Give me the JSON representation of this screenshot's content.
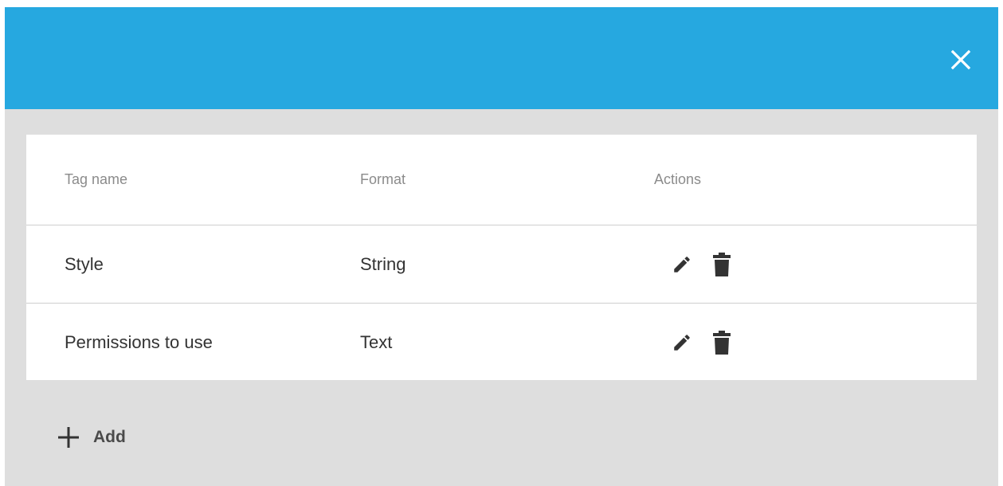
{
  "dialog": {
    "close_icon": "close-icon",
    "header_color": "#26a8e0"
  },
  "table": {
    "headers": {
      "name": "Tag name",
      "format": "Format",
      "actions": "Actions"
    },
    "rows": [
      {
        "name": "Style",
        "format": "String",
        "actions": [
          "edit-icon",
          "delete-icon"
        ]
      },
      {
        "name": "Permissions to use",
        "format": "Text",
        "actions": [
          "edit-icon",
          "delete-icon"
        ]
      }
    ]
  },
  "footer": {
    "add_label": "Add",
    "add_icon": "plus-icon"
  }
}
